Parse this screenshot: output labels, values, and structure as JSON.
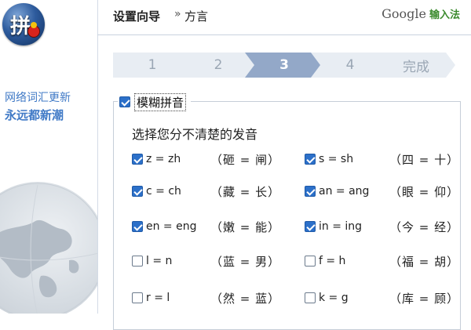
{
  "sidebar": {
    "logo_glyph": "拼",
    "slogan_line1": "网络词汇更新",
    "slogan_line2": "永远都新潮"
  },
  "header": {
    "title": "设置向导",
    "separator": "»",
    "subtitle": "方言",
    "brand_google": "Google",
    "brand_product": "输入法"
  },
  "steps": {
    "items": [
      "1",
      "2",
      "3",
      "4",
      "完成"
    ],
    "active_index": 2
  },
  "fuzzy": {
    "legend": "模糊拼音",
    "legend_checked": true,
    "prompt": "选择您分不清楚的发音",
    "options": [
      {
        "label": "z = zh",
        "example": "（砸 = 闸）",
        "checked": true
      },
      {
        "label": "s = sh",
        "example": "（四 = 十）",
        "checked": true
      },
      {
        "label": "c = ch",
        "example": "（藏 = 长）",
        "checked": true
      },
      {
        "label": "an = ang",
        "example": "（眼 = 仰）",
        "checked": true
      },
      {
        "label": "en = eng",
        "example": "（嫩 = 能）",
        "checked": true
      },
      {
        "label": "in = ing",
        "example": "（今 = 经）",
        "checked": true
      },
      {
        "label": "l = n",
        "example": "（蓝 = 男）",
        "checked": false
      },
      {
        "label": "f = h",
        "example": "（福 = 胡）",
        "checked": false
      },
      {
        "label": "r = l",
        "example": "（然 = 蓝）",
        "checked": false
      },
      {
        "label": "k = g",
        "example": "（库 = 顾）",
        "checked": false
      }
    ]
  },
  "colors": {
    "accent": "#2c70c9",
    "step_active": "#93a8c8",
    "step_inactive": "#e8edf3",
    "slogan": "#3f79c6"
  }
}
